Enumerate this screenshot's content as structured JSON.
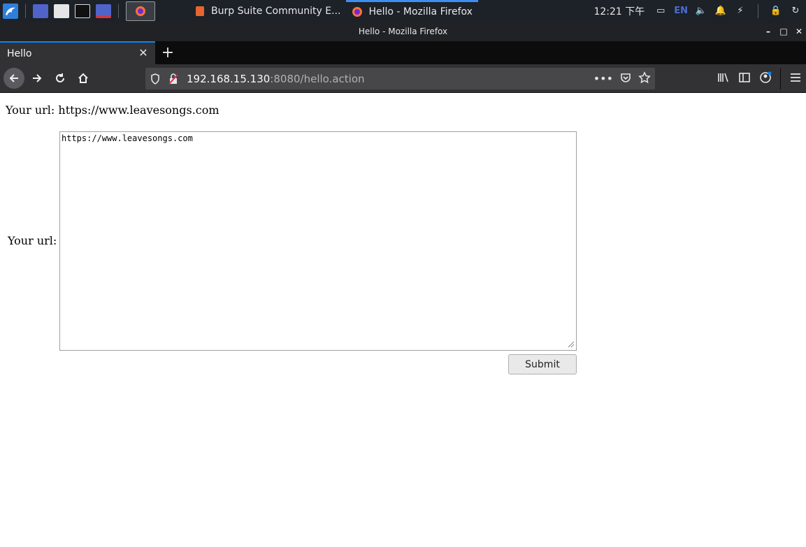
{
  "panel": {
    "tasks": [
      {
        "label": "Burp Suite Community E..."
      },
      {
        "label": "Hello - Mozilla Firefox"
      }
    ],
    "clock": "12:21 下午",
    "lang": "EN"
  },
  "window": {
    "title": "Hello - Mozilla Firefox"
  },
  "browser": {
    "tab_title": "Hello",
    "url_host": "192.168.15.130",
    "url_path": ":8080/hello.action"
  },
  "page": {
    "result_text": "Your url: https://www.leavesongs.com",
    "form_label": "Your url:",
    "textarea_value": "https://www.leavesongs.com",
    "submit_label": "Submit"
  },
  "colors": {
    "accent": "#0a84ff",
    "panel_bg": "#1d2128",
    "toolbar_bg": "#323234"
  }
}
